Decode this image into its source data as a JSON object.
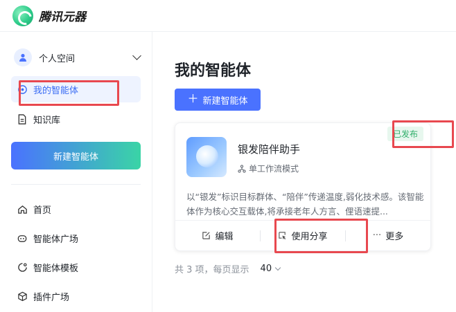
{
  "app": {
    "title": "腾讯元器"
  },
  "sidebar": {
    "space_label": "个人空间",
    "items_top": [
      {
        "label": "我的智能体",
        "icon": "agent-icon",
        "active": true
      },
      {
        "label": "知识库",
        "icon": "document-icon",
        "active": false
      }
    ],
    "new_agent_button": "新建智能体",
    "items_bottom": [
      {
        "label": "首页",
        "icon": "home-icon"
      },
      {
        "label": "智能体广场",
        "icon": "bot-icon"
      },
      {
        "label": "智能体模板",
        "icon": "template-icon"
      },
      {
        "label": "插件广场",
        "icon": "cube-icon"
      }
    ]
  },
  "main": {
    "page_title": "我的智能体",
    "create_button": "新建智能体",
    "card": {
      "name": "银发陪伴助手",
      "mode": "单工作流模式",
      "status": "已发布",
      "description": "以“银发”标识目标群体、“陪伴”传递温度,弱化技术感。该智能体作为核心交互载体,将承接老年人方言、俚语速提...",
      "actions": [
        "编辑",
        "使用分享",
        "更多"
      ]
    },
    "pagination": {
      "summary": "共 3 项，每页显示",
      "page_size": "40"
    }
  },
  "colors": {
    "accent": "#4a72ff",
    "published": "#2fae6a",
    "highlight": "#e8484f"
  }
}
